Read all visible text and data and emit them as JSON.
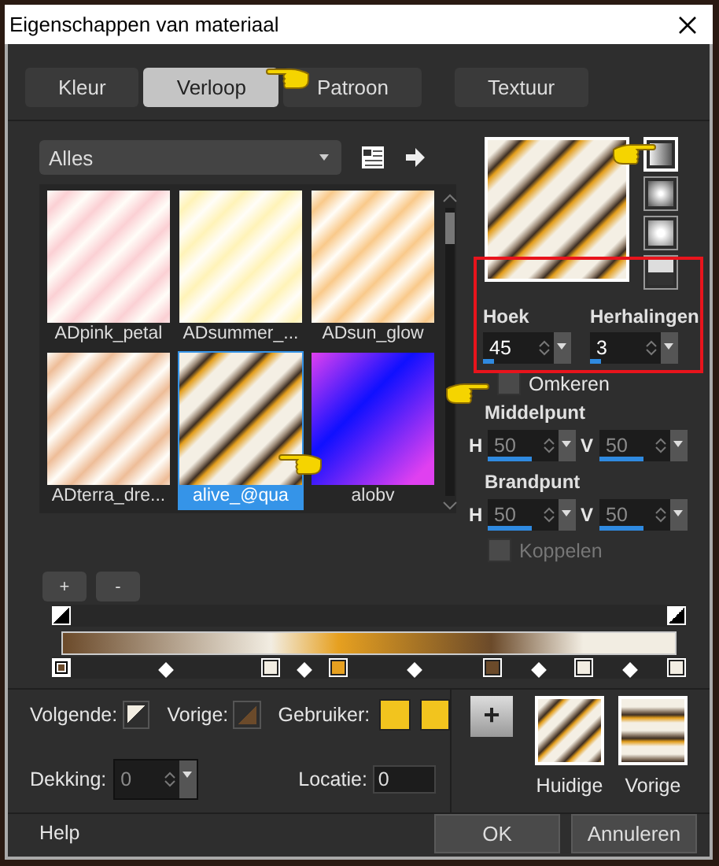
{
  "window": {
    "title": "Eigenschappen van materiaal"
  },
  "tabs": [
    {
      "label": "Kleur",
      "selected": false
    },
    {
      "label": "Verloop",
      "selected": true
    },
    {
      "label": "Patroon",
      "selected": false
    },
    {
      "label": "Textuur",
      "selected": false
    }
  ],
  "filter": {
    "value": "Alles"
  },
  "gradients": [
    {
      "name": "ADpink_petal",
      "kind": "pastel",
      "color": "#fbd0d4",
      "selected": false
    },
    {
      "name": "ADsummer_...",
      "kind": "pastel",
      "color": "#fff3b8",
      "selected": false
    },
    {
      "name": "ADsun_glow",
      "kind": "pastel",
      "color": "#f9c98a",
      "selected": false
    },
    {
      "name": "ADterra_dre...",
      "kind": "pastel",
      "color": "#eebd98",
      "selected": false
    },
    {
      "name": "alive_@qua",
      "kind": "metallic",
      "color": "#e39e1c",
      "selected": true
    },
    {
      "name": "alobv",
      "kind": "blend",
      "color": "#1010ff",
      "selected": false
    }
  ],
  "styles": [
    {
      "kind": "linear",
      "selected": true
    },
    {
      "kind": "rectangular",
      "selected": false
    },
    {
      "kind": "sunburst",
      "selected": false
    },
    {
      "kind": "radial",
      "selected": false
    }
  ],
  "angle": {
    "label": "Hoek",
    "value": "45",
    "level": 0.12
  },
  "repeats": {
    "label": "Herhalingen",
    "value": "3",
    "level": 0.12
  },
  "invert": {
    "label": "Omkeren",
    "checked": false
  },
  "center": {
    "label": "Middelpunt",
    "fields": [
      {
        "label": "H",
        "value": "50",
        "level": 0.5,
        "disabled": true
      },
      {
        "label": "V",
        "value": "50",
        "level": 0.5,
        "disabled": true
      }
    ]
  },
  "focus": {
    "label": "Brandpunt",
    "fields": [
      {
        "label": "H",
        "value": "50",
        "level": 0.5,
        "disabled": true
      },
      {
        "label": "V",
        "value": "50",
        "level": 0.5,
        "disabled": true
      }
    ]
  },
  "link": {
    "label": "Koppelen",
    "checked": false,
    "disabled": true
  },
  "stop_buttons": [
    "+",
    "-"
  ],
  "opacity_stops": [
    {
      "level": 0
    },
    {
      "level": 1
    }
  ],
  "color_stops": [
    {
      "color": "#6b4a2a",
      "level": 0,
      "selected": true
    },
    {
      "color": "#f2ede2",
      "level": 0.34,
      "selected": false
    },
    {
      "color": "#e6a020",
      "level": 0.45,
      "selected": false
    },
    {
      "color": "#6b4a2a",
      "level": 0.7,
      "selected": false
    },
    {
      "color": "#f2ede2",
      "level": 0.85,
      "selected": false
    },
    {
      "color": "#f2ede2",
      "level": 1,
      "selected": false
    }
  ],
  "next": {
    "label": "Volgende:"
  },
  "previous": {
    "label": "Vorige:"
  },
  "user": {
    "label": "Gebruiker:",
    "swatches": [
      {
        "color": "#f2c41e"
      },
      {
        "color": "#f2c41e"
      }
    ]
  },
  "opacity": {
    "label": "Dekking:",
    "value": "0",
    "disabled": true
  },
  "location": {
    "label": "Locatie:",
    "value": "0"
  },
  "add_button": "+",
  "previews": [
    {
      "label": "Huidige",
      "kind": "diagonal"
    },
    {
      "label": "Vorige",
      "kind": "horizontal"
    }
  ],
  "help": "Help",
  "buttons": [
    "OK",
    "Annuleren"
  ]
}
